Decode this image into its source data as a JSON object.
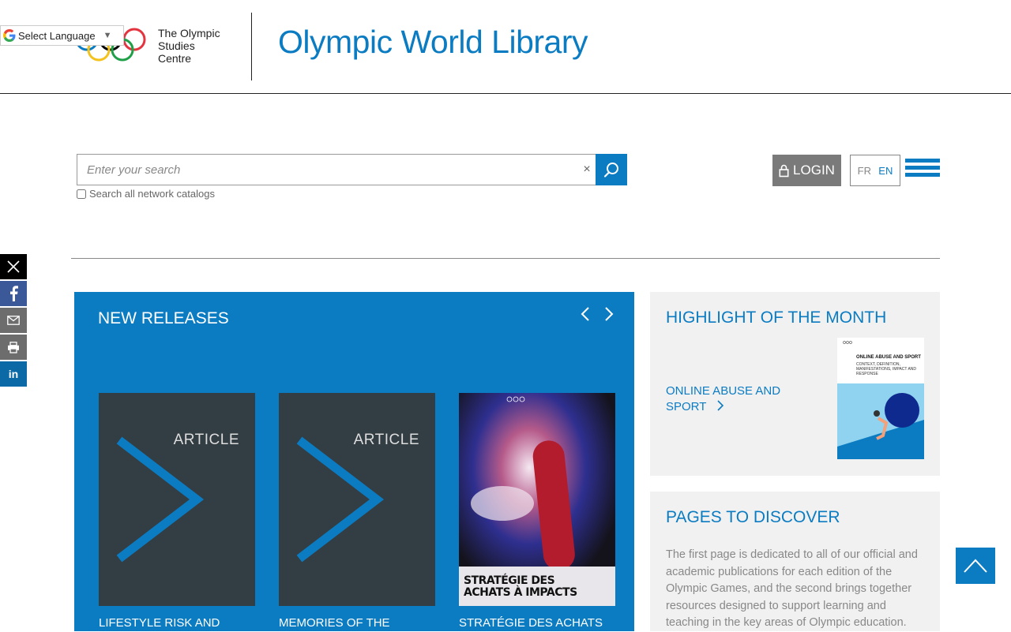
{
  "header": {
    "org_lines": [
      "The Olympic",
      "Studies",
      "Centre"
    ],
    "site_title": "Olympic World Library",
    "translate_label": "Select Language"
  },
  "search": {
    "placeholder": "Enter your search",
    "clear_symbol": "×",
    "network_label": "Search all network catalogs"
  },
  "account": {
    "login_label": "LOGIN",
    "lang_fr": "FR",
    "lang_en": "EN"
  },
  "new_releases": {
    "title": "NEW RELEASES",
    "items": [
      {
        "type": "ARTICLE",
        "title": "LIFESTYLE RISK AND"
      },
      {
        "type": "ARTICLE",
        "title": "MEMORIES OF THE"
      },
      {
        "cover_title": "STRATÉGIE DES ACHATS À IMPACTS",
        "title": "STRATÉGIE DES ACHATS"
      }
    ]
  },
  "highlight": {
    "title": "HIGHLIGHT OF THE MONTH",
    "link_label": "ONLINE ABUSE AND SPORT",
    "cover_title": "ONLINE ABUSE AND SPORT",
    "cover_subtitle": "CONTEXT, DEFINITION, MANIFESTATIONS, IMPACT AND RESPONSE"
  },
  "pages_to_discover": {
    "title": "PAGES TO DISCOVER",
    "text": "The first page is dedicated to all of our official and academic publications for each edition of the Olympic Games, and the second brings together resources designed to support learning and teaching in the key areas of Olympic education."
  },
  "colors": {
    "brand_blue": "#0b7cc2",
    "login_grey": "#7a7a7a",
    "panel_grey": "#f1f1f1"
  },
  "icons": [
    "google-icon",
    "search-icon",
    "lock-icon",
    "menu-icon",
    "x-icon",
    "facebook-icon",
    "mail-icon",
    "print-icon",
    "linkedin-icon",
    "chevron-left-icon",
    "chevron-right-icon",
    "arrow-up-icon"
  ]
}
